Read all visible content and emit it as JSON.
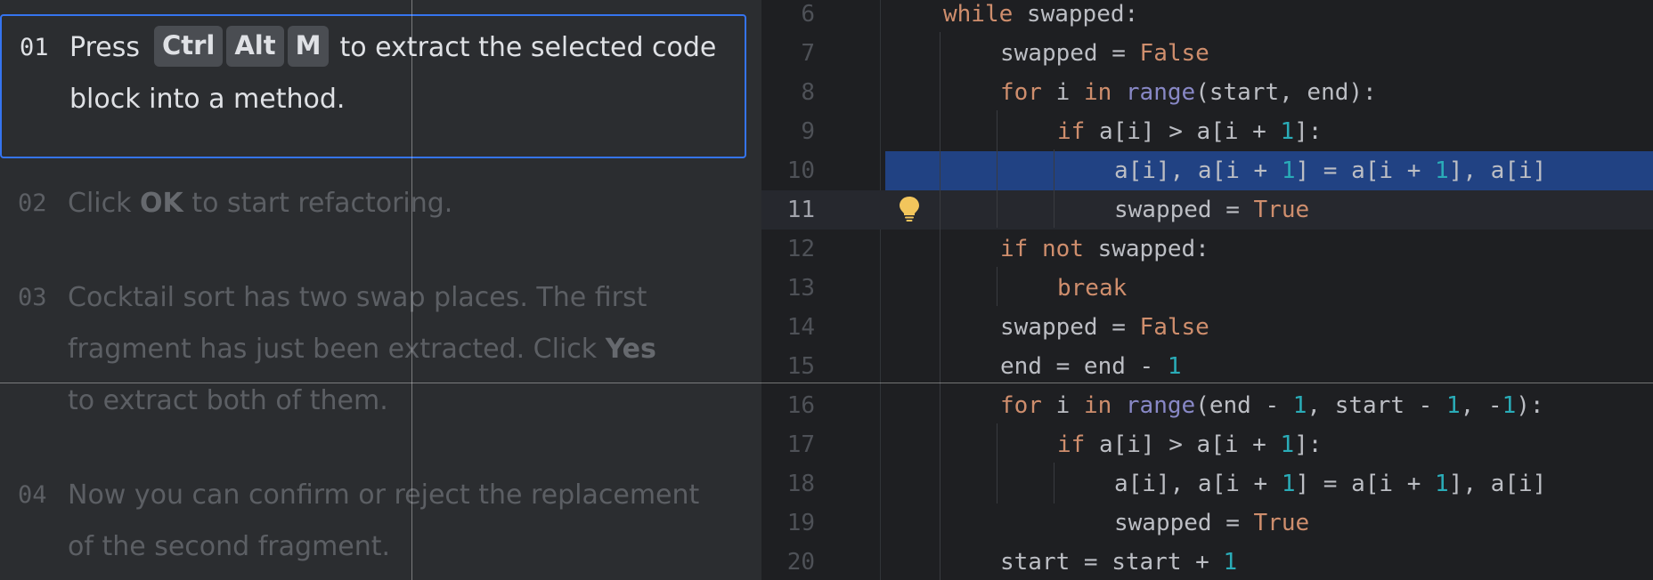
{
  "steps": [
    {
      "num": "01",
      "prefix": "Press",
      "keys": [
        "Ctrl",
        "Alt",
        "M"
      ],
      "suffix": "to extract the selected code block into a method."
    },
    {
      "num": "02",
      "before": "Click ",
      "bold": "OK",
      "after": " to start refactoring."
    },
    {
      "num": "03",
      "before": "Cocktail sort has two swap places. The first fragment has just been extracted. Click ",
      "bold": "Yes",
      "after": " to extract both of them."
    },
    {
      "num": "04",
      "text": "Now you can confirm or reject the replacement of the second fragment."
    }
  ],
  "editor": {
    "lines": [
      {
        "num": "6",
        "tokens": [
          [
            "kw",
            "while"
          ],
          [
            "t",
            " swapped:"
          ]
        ]
      },
      {
        "num": "7",
        "tokens": [
          [
            "t",
            "swapped = "
          ],
          [
            "kw",
            "False"
          ]
        ]
      },
      {
        "num": "8",
        "tokens": [
          [
            "kw",
            "for"
          ],
          [
            "t",
            " i "
          ],
          [
            "kw",
            "in"
          ],
          [
            "t",
            " "
          ],
          [
            "bi",
            "range"
          ],
          [
            "t",
            "(start, end):"
          ]
        ]
      },
      {
        "num": "9",
        "tokens": [
          [
            "kw",
            "if"
          ],
          [
            "t",
            " a[i] > a[i + "
          ],
          [
            "num",
            "1"
          ],
          [
            "t",
            "]:"
          ]
        ]
      },
      {
        "num": "10",
        "tokens": [
          [
            "t",
            "a[i], a[i + "
          ],
          [
            "num",
            "1"
          ],
          [
            "t",
            "] = a[i + "
          ],
          [
            "num",
            "1"
          ],
          [
            "t",
            "], a[i]"
          ]
        ]
      },
      {
        "num": "11",
        "tokens": [
          [
            "t",
            "swapped = "
          ],
          [
            "kw",
            "True"
          ]
        ]
      },
      {
        "num": "12",
        "tokens": [
          [
            "kw",
            "if"
          ],
          [
            "t",
            " "
          ],
          [
            "kw",
            "not"
          ],
          [
            "t",
            " swapped:"
          ]
        ]
      },
      {
        "num": "13",
        "tokens": [
          [
            "kw",
            "break"
          ]
        ]
      },
      {
        "num": "14",
        "tokens": [
          [
            "t",
            "swapped = "
          ],
          [
            "kw",
            "False"
          ]
        ]
      },
      {
        "num": "15",
        "tokens": [
          [
            "t",
            "end = end - "
          ],
          [
            "num",
            "1"
          ]
        ]
      },
      {
        "num": "16",
        "tokens": [
          [
            "kw",
            "for"
          ],
          [
            "t",
            " i "
          ],
          [
            "kw",
            "in"
          ],
          [
            "t",
            " "
          ],
          [
            "bi",
            "range"
          ],
          [
            "t",
            "(end - "
          ],
          [
            "num",
            "1"
          ],
          [
            "t",
            ", start - "
          ],
          [
            "num",
            "1"
          ],
          [
            "t",
            ", -"
          ],
          [
            "num",
            "1"
          ],
          [
            "t",
            "):"
          ]
        ]
      },
      {
        "num": "17",
        "tokens": [
          [
            "kw",
            "if"
          ],
          [
            "t",
            " a[i] > a[i + "
          ],
          [
            "num",
            "1"
          ],
          [
            "t",
            "]:"
          ]
        ]
      },
      {
        "num": "18",
        "tokens": [
          [
            "t",
            "a[i], a[i + "
          ],
          [
            "num",
            "1"
          ],
          [
            "t",
            "] = a[i + "
          ],
          [
            "num",
            "1"
          ],
          [
            "t",
            "], a[i]"
          ]
        ]
      },
      {
        "num": "19",
        "tokens": [
          [
            "t",
            "swapped = "
          ],
          [
            "kw",
            "True"
          ]
        ]
      },
      {
        "num": "20",
        "tokens": [
          [
            "t",
            "start = start + "
          ],
          [
            "num",
            "1"
          ]
        ]
      }
    ],
    "selected_line": "10",
    "caret_line": "11",
    "intention_icon": "lightbulb-icon"
  },
  "colors": {
    "accent": "#3574f0",
    "keyword": "#cf8e6d",
    "number": "#2aacb8",
    "builtin": "#8888c6",
    "selection": "#214283",
    "bulb": "#f2c55c"
  }
}
